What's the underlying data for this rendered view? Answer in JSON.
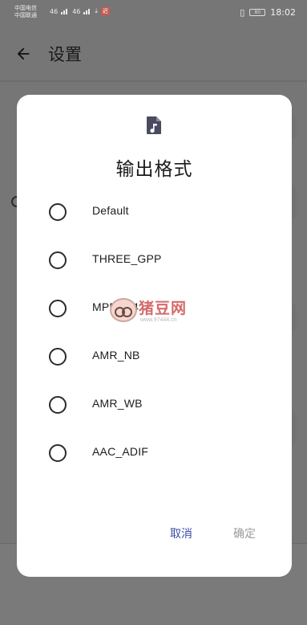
{
  "statusbar": {
    "carrier_1": "中国电信",
    "carrier_2": "中国联通",
    "time": "18:02",
    "battery": "80",
    "net_1": "46",
    "net_2": "46",
    "alert_icon": "迟"
  },
  "appbar": {
    "title": "设置",
    "back_icon": "arrow-left-icon"
  },
  "dialog": {
    "icon": "music-file-icon",
    "title": "输出格式",
    "options": [
      {
        "label": "Default",
        "selected": false
      },
      {
        "label": "THREE_GPP",
        "selected": false
      },
      {
        "label": "MPEG_4",
        "selected": false
      },
      {
        "label": "AMR_NB",
        "selected": false
      },
      {
        "label": "AMR_WB",
        "selected": false
      },
      {
        "label": "AAC_ADIF",
        "selected": false
      }
    ],
    "cancel_label": "取消",
    "ok_label": "确定"
  },
  "watermark": {
    "name": "猪豆网",
    "url": "www.97444.cn"
  },
  "colors": {
    "accent": "#3a4ca8",
    "disabled": "#9c9c9c",
    "scrim": "#767676"
  }
}
